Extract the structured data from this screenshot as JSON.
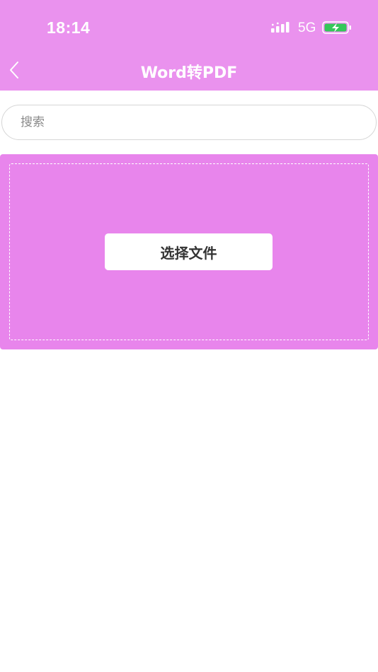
{
  "status_bar": {
    "time": "18:14",
    "network": "5G",
    "signal_icon": "signal-bars-icon",
    "battery_icon": "battery-charging-icon",
    "battery_color": "#34c759"
  },
  "nav_bar": {
    "back_icon": "chevron-left-icon",
    "title": "Word转PDF",
    "background": "#ea92ee"
  },
  "search": {
    "placeholder": "搜索",
    "value": ""
  },
  "upload": {
    "background": "#e885ec",
    "button_label": "选择文件"
  }
}
